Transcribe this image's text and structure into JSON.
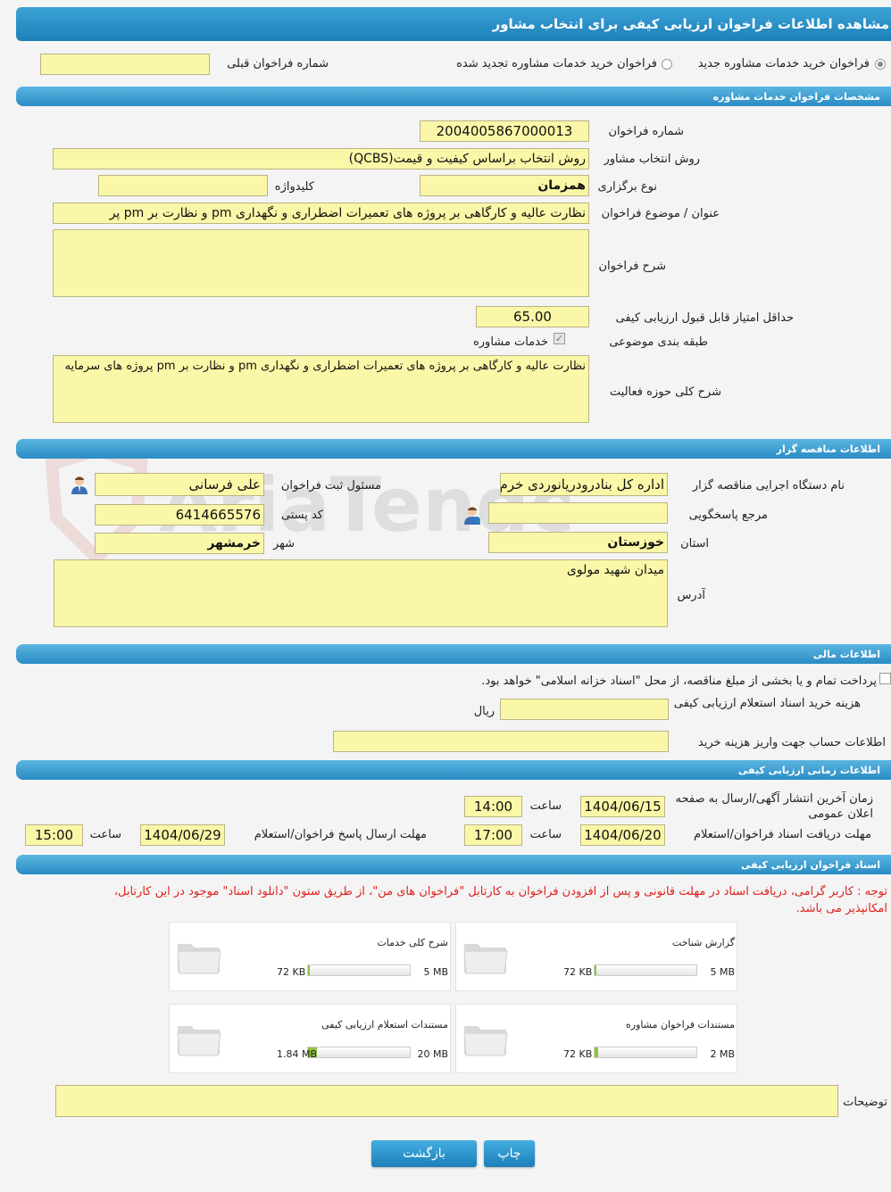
{
  "header": {
    "title": "مشاهده اطلاعات فراخوان ارزیابی کیفی برای انتخاب مشاور"
  },
  "top": {
    "radio_new": "فراخوان خرید خدمات مشاوره جدید",
    "radio_renewed": "فراخوان خرید خدمات مشاوره تجدید شده",
    "prev_label": "شماره فراخوان قبلی",
    "prev_value": ""
  },
  "spec": {
    "section_title": "مشخصات فراخوان خدمات مشاوره",
    "number_label": "شماره فراخوان",
    "number_value": "2004005867000013",
    "method_label": "روش انتخاب مشاور",
    "method_value": "روش انتخاب براساس کیفیت و قیمت(QCBS)",
    "type_label": "نوع برگزاری",
    "type_value": "همزمان",
    "keyword_label": "کلیدواژه",
    "keyword_value": "",
    "subject_label": "عنوان / موضوع فراخوان",
    "subject_value": "نظارت عالیه و کارگاهی بر پروژه های تعمیرات اضطراری و نگهداری pm و نظارت بر pm پر",
    "desc_label": "شرح فراخوان",
    "desc_value": "",
    "min_score_label": "حداقل امتیاز قابل قبول ارزیابی کیفی",
    "min_score_value": "65.00",
    "category_label": "طبقه بندی موضوعی",
    "category_value": "خدمات مشاوره",
    "activity_label": "شرح کلی حوزه فعالیت",
    "activity_value": "نظارت عالیه و کارگاهی بر پروژه های تعمیرات اضطراری و نگهداری pm و نظارت بر pm پروژه های سرمایه"
  },
  "tenderer": {
    "section_title": "اطلاعات مناقصه گزار",
    "org_label": "نام دستگاه اجرایی مناقصه گزار",
    "org_value": "اداره کل بنادرودریانوردی خرم",
    "registrar_label": "مسئول ثبت فراخوان",
    "registrar_value": "علی  فرسانی",
    "ref_label": "مرجع پاسخگویی",
    "ref_value": "",
    "postal_label": "کد پستی",
    "postal_value": "6414665576",
    "province_label": "استان",
    "province_value": "خوزستان",
    "city_label": "شهر",
    "city_value": "خرمشهر",
    "address_label": "آدرس",
    "address_value": "میدان شهید مولوی"
  },
  "financial": {
    "section_title": "اطلاعات مالی",
    "payment_text": "پرداخت تمام و یا بخشی از مبلغ مناقصه، از محل \"اسناد خزانه اسلامی\" خواهد بود.",
    "cost_label": "هزینه خرید اسناد استعلام ارزیابی کیفی",
    "cost_value": "",
    "currency": "ریال",
    "account_label": "اطلاعات حساب جهت واریز هزینه خرید",
    "account_value": ""
  },
  "timing": {
    "section_title": "اطلاعات زمانی ارزیابی کیفی",
    "publish_label": "زمان آخرین انتشار آگهی/ارسال به صفحه اعلان عمومی",
    "publish_date": "1404/06/15",
    "publish_time": "14:00",
    "receive_label": "مهلت دریافت اسناد فراخوان/استعلام",
    "receive_date": "1404/06/20",
    "receive_time": "17:00",
    "reply_label": "مهلت ارسال پاسخ فراخوان/استعلام",
    "reply_date": "1404/06/29",
    "reply_time": "15:00",
    "time_label": "ساعت"
  },
  "documents": {
    "section_title": "اسناد فراخوان ارزیابی کیفی",
    "notice_line1": "توجه : کاربر گرامی، دریافت اسناد در مهلت قانونی و پس از افزودن فراخوان به کارتابل \"فراخوان های من\"، از طریق ستون \"دانلود اسناد\" موجود در این کارتابل،",
    "notice_line2": "امکانپذیر می باشد.",
    "items": [
      {
        "name": "گزارش شناخت",
        "used": "72 KB",
        "max": "5 MB",
        "fill": 0.02
      },
      {
        "name": "شرح کلی خدمات",
        "used": "72 KB",
        "max": "5 MB",
        "fill": 0.02
      },
      {
        "name": "مستندات فراخوان مشاوره",
        "used": "72 KB",
        "max": "2 MB",
        "fill": 0.035
      },
      {
        "name": "مستندات استعلام ارزیابی کیفی",
        "used": "1.84 MB",
        "max": "20 MB",
        "fill": 0.092
      }
    ],
    "notes_label": "توضیحات",
    "notes_value": ""
  },
  "actions": {
    "print": "چاپ",
    "back": "بازگشت"
  },
  "colors": {
    "header": "#1e7fb8",
    "field": "#fbf7a8",
    "notice": "#e0201a",
    "progress": "#8cc63f"
  }
}
